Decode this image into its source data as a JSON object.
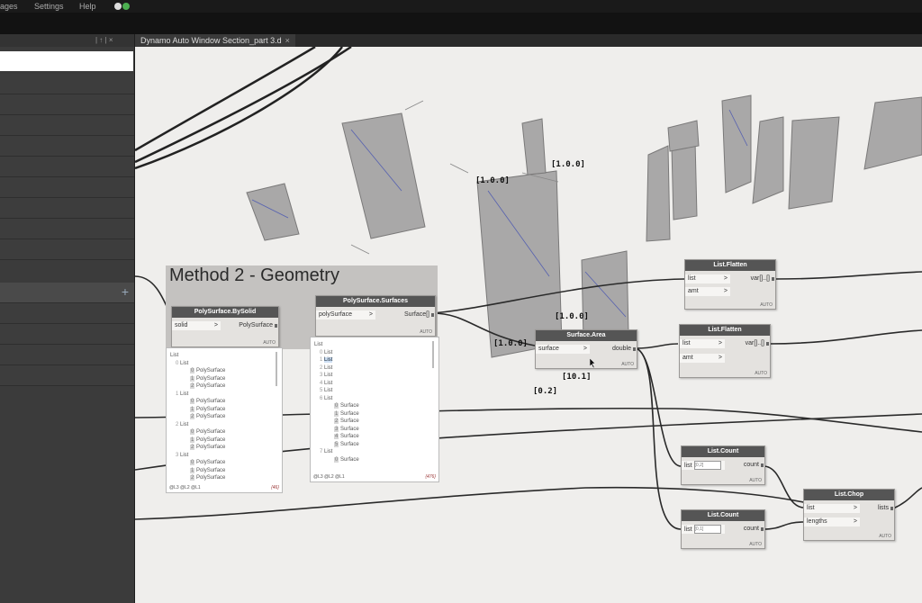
{
  "menu": {
    "items": [
      "ages",
      "Settings",
      "Help"
    ]
  },
  "tab": {
    "title": "Dynamo Auto Window Section_part 3.d",
    "close": "×"
  },
  "library": {
    "header_controls": "| ↑ | ×",
    "search_value": "",
    "plus": "+"
  },
  "group": {
    "title": "Method 2 - Geometry"
  },
  "nodes": {
    "bysolid": {
      "title": "PolySurface.BySolid",
      "input": "solid",
      "output": "PolySurface",
      "auto": "AUTO"
    },
    "surfaces": {
      "title": "PolySurface.Surfaces",
      "input": "polySurface",
      "output": "Surface[]",
      "auto": "AUTO"
    },
    "area": {
      "title": "Surface.Area",
      "input": "surface",
      "output": "double",
      "auto": "AUTO"
    },
    "flatten1": {
      "title": "List.Flatten",
      "in1": "list",
      "in2": "amt",
      "output": "var[]..[]",
      "auto": "AUTO"
    },
    "flatten2": {
      "title": "List.Flatten",
      "in1": "list",
      "in2": "amt",
      "output": "var[]..[]",
      "auto": "AUTO"
    },
    "count1": {
      "title": "List.Count",
      "input": "list",
      "default": "[0,2]",
      "output": "count",
      "auto": "AUTO"
    },
    "count2": {
      "title": "List.Count",
      "input": "list",
      "default": "[0,1]",
      "output": "count",
      "auto": "AUTO"
    },
    "chop": {
      "title": "List.Chop",
      "in1": "list",
      "in2": "lengths",
      "output": "lists",
      "auto": "AUTO"
    }
  },
  "preview1": {
    "rows": [
      {
        "idx": "",
        "tag": "",
        "val": "List"
      },
      {
        "idx": "0",
        "tag": "",
        "val": "List"
      },
      {
        "idx": "",
        "tag": "0",
        "val": "PolySurface"
      },
      {
        "idx": "",
        "tag": "1",
        "val": "PolySurface"
      },
      {
        "idx": "",
        "tag": "2",
        "val": "PolySurface"
      },
      {
        "idx": "1",
        "tag": "",
        "val": "List"
      },
      {
        "idx": "",
        "tag": "0",
        "val": "PolySurface"
      },
      {
        "idx": "",
        "tag": "1",
        "val": "PolySurface"
      },
      {
        "idx": "",
        "tag": "2",
        "val": "PolySurface"
      },
      {
        "idx": "2",
        "tag": "",
        "val": "List"
      },
      {
        "idx": "",
        "tag": "0",
        "val": "PolySurface"
      },
      {
        "idx": "",
        "tag": "1",
        "val": "PolySurface"
      },
      {
        "idx": "",
        "tag": "2",
        "val": "PolySurface"
      },
      {
        "idx": "3",
        "tag": "",
        "val": "List"
      },
      {
        "idx": "",
        "tag": "0",
        "val": "PolySurface"
      },
      {
        "idx": "",
        "tag": "1",
        "val": "PolySurface"
      },
      {
        "idx": "",
        "tag": "2",
        "val": "PolySurface"
      }
    ],
    "footer": "@L3 @L2 @L1",
    "count": "{46}"
  },
  "preview2": {
    "rows": [
      {
        "idx": "",
        "tag": "",
        "val": "List"
      },
      {
        "idx": "0",
        "tag": "",
        "val": "List"
      },
      {
        "idx": "1",
        "tag": "",
        "val": "List"
      },
      {
        "idx": "2",
        "tag": "",
        "val": "List"
      },
      {
        "idx": "3",
        "tag": "",
        "val": "List"
      },
      {
        "idx": "4",
        "tag": "",
        "val": "List"
      },
      {
        "idx": "5",
        "tag": "",
        "val": "List"
      },
      {
        "idx": "6",
        "tag": "",
        "val": "List"
      },
      {
        "idx": "",
        "tag": "0",
        "val": "Surface"
      },
      {
        "idx": "",
        "tag": "1",
        "val": "Surface"
      },
      {
        "idx": "",
        "tag": "2",
        "val": "Surface"
      },
      {
        "idx": "",
        "tag": "3",
        "val": "Surface"
      },
      {
        "idx": "",
        "tag": "4",
        "val": "Surface"
      },
      {
        "idx": "",
        "tag": "5",
        "val": "Surface"
      },
      {
        "idx": "7",
        "tag": "",
        "val": "List"
      },
      {
        "idx": "",
        "tag": "0",
        "val": "Surface"
      }
    ],
    "selected_index": 2,
    "footer": "@L3 @L2 @L1",
    "count": "{476}"
  },
  "geometry_labels": [
    {
      "text": "[1.0.0]"
    },
    {
      "text": "[1.0.0]"
    },
    {
      "text": "[1.0.0]"
    },
    {
      "text": "[1.0.0]"
    },
    {
      "text": "[0.2]"
    },
    {
      "text": "[10.1]"
    }
  ]
}
